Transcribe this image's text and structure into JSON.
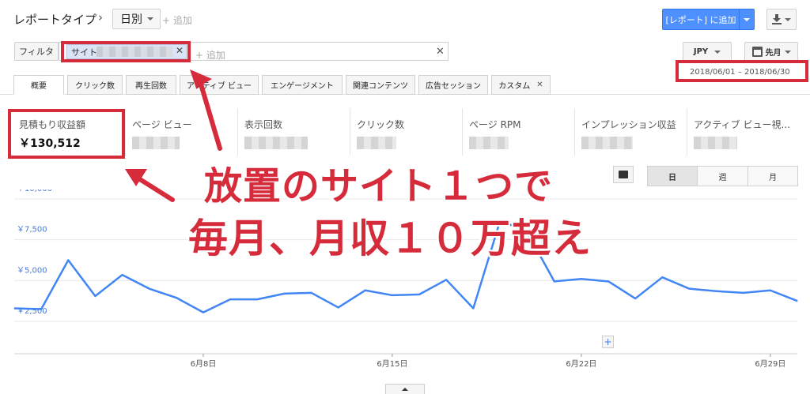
{
  "header": {
    "report_type": "レポートタイプ",
    "chevron": "›",
    "period_select": "日別",
    "add_link": "+ 追加",
    "add_to_report": "[レポート] に追加"
  },
  "filter": {
    "label": "フィルタ",
    "chip_label": "サイト",
    "add_placeholder": "+ 追加",
    "clear": "✕",
    "chip_remove": "✕"
  },
  "currency": "JPY",
  "period_button": "先月",
  "date_range": "2018/06/01 – 2018/06/30",
  "tabs": [
    {
      "label": "概要",
      "active": true
    },
    {
      "label": "クリック数"
    },
    {
      "label": "再生回数"
    },
    {
      "label": "アクティブ ビュー"
    },
    {
      "label": "エンゲージメント"
    },
    {
      "label": "関連コンテンツ"
    },
    {
      "label": "広告セッション"
    },
    {
      "label": "カスタム",
      "closable": true,
      "close": "✕"
    }
  ],
  "metrics": [
    {
      "label": "見積もり収益額",
      "value": "￥130,512"
    },
    {
      "label": "ページ ビュー"
    },
    {
      "label": "表示回数"
    },
    {
      "label": "クリック数"
    },
    {
      "label": "ページ RPM"
    },
    {
      "label": "インプレッション収益"
    },
    {
      "label": "アクティブ ビュー視..."
    }
  ],
  "granularity": {
    "day": "日",
    "week": "週",
    "month": "月",
    "active": "日"
  },
  "overlay": {
    "line1": "放置のサイト１つで",
    "line2": "毎月、月収１０万超え",
    "color": "#d52b3a"
  },
  "chart_data": {
    "type": "line",
    "y_tick_labels": [
      "￥10,000",
      "￥7,500",
      "￥5,000",
      "￥2,500"
    ],
    "y_ticks": [
      10000,
      7500,
      5000,
      2500
    ],
    "ylim": [
      0,
      11000
    ],
    "x_tick_labels": [
      "6月8日",
      "6月15日",
      "6月22日",
      "6月29日"
    ],
    "x_tick_days": [
      8,
      15,
      22,
      29
    ],
    "x": [
      1,
      2,
      3,
      4,
      5,
      6,
      7,
      8,
      9,
      10,
      11,
      12,
      13,
      14,
      15,
      16,
      17,
      18,
      19,
      20,
      21,
      22,
      23,
      24,
      25,
      26,
      27,
      28,
      29,
      30
    ],
    "values": [
      3300,
      3250,
      6250,
      4050,
      5350,
      4500,
      3950,
      3050,
      3850,
      3850,
      4200,
      4250,
      3350,
      4400,
      4100,
      4150,
      5050,
      3300,
      8700,
      7950,
      4950,
      5100,
      4950,
      3900,
      5200,
      4500,
      4350,
      4250,
      4400,
      3750
    ],
    "line_color": "#4285f4"
  }
}
